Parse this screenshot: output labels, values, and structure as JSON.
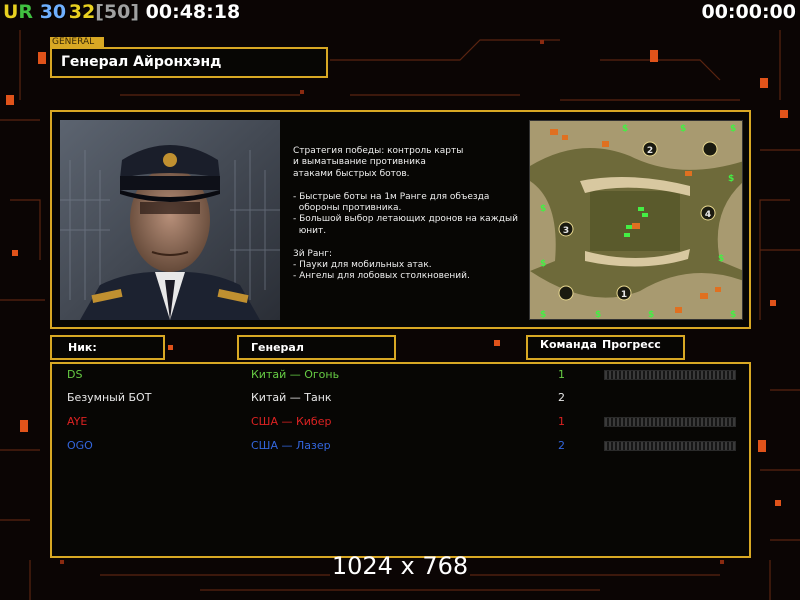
{
  "hud": {
    "prefix": "UR",
    "fps": "30",
    "fps_cur": "32",
    "fps_cap": "[50]",
    "elapsed": "00:48:18",
    "timer": "00:00:00"
  },
  "general_tag": "GENERAL",
  "general_name": "Генерал Айронхэнд",
  "description": [
    "Стратегия победы: контроль карты",
    "и выматывание противника",
    "атаками быстрых ботов.",
    "",
    "- Быстрые боты на 1м Ранге для объезда",
    "  обороны противника.",
    "- Большой выбор летающих дронов на каждый",
    "  юнит.",
    "",
    "3й Ранг:",
    "- Пауки для мобильных атак.",
    "- Ангелы для лобовых столкновений."
  ],
  "minimap": {
    "spawns": [
      "1",
      "2",
      "3",
      "4"
    ],
    "resource_glyph": "$"
  },
  "columns": {
    "nick": "Ник:",
    "general": "Генерал",
    "team": "Команда",
    "progress": "Прогресс"
  },
  "players": [
    {
      "nick": "DS",
      "general": "Китай — Огонь",
      "team": "1",
      "color": "#66cc44",
      "progress": true
    },
    {
      "nick": "Безумный БОТ",
      "general": "Китай — Танк",
      "team": "2",
      "color": "#e8e8e8",
      "progress": false
    },
    {
      "nick": "AYE",
      "general": "США — Кибер",
      "team": "1",
      "color": "#dd2222",
      "progress": true
    },
    {
      "nick": "OGO",
      "general": "США — Лазер",
      "team": "2",
      "color": "#3366dd",
      "progress": true
    }
  ],
  "resolution": "1024 x 768",
  "colors": {
    "accent": "#d8a824",
    "background": "#0b0504"
  }
}
